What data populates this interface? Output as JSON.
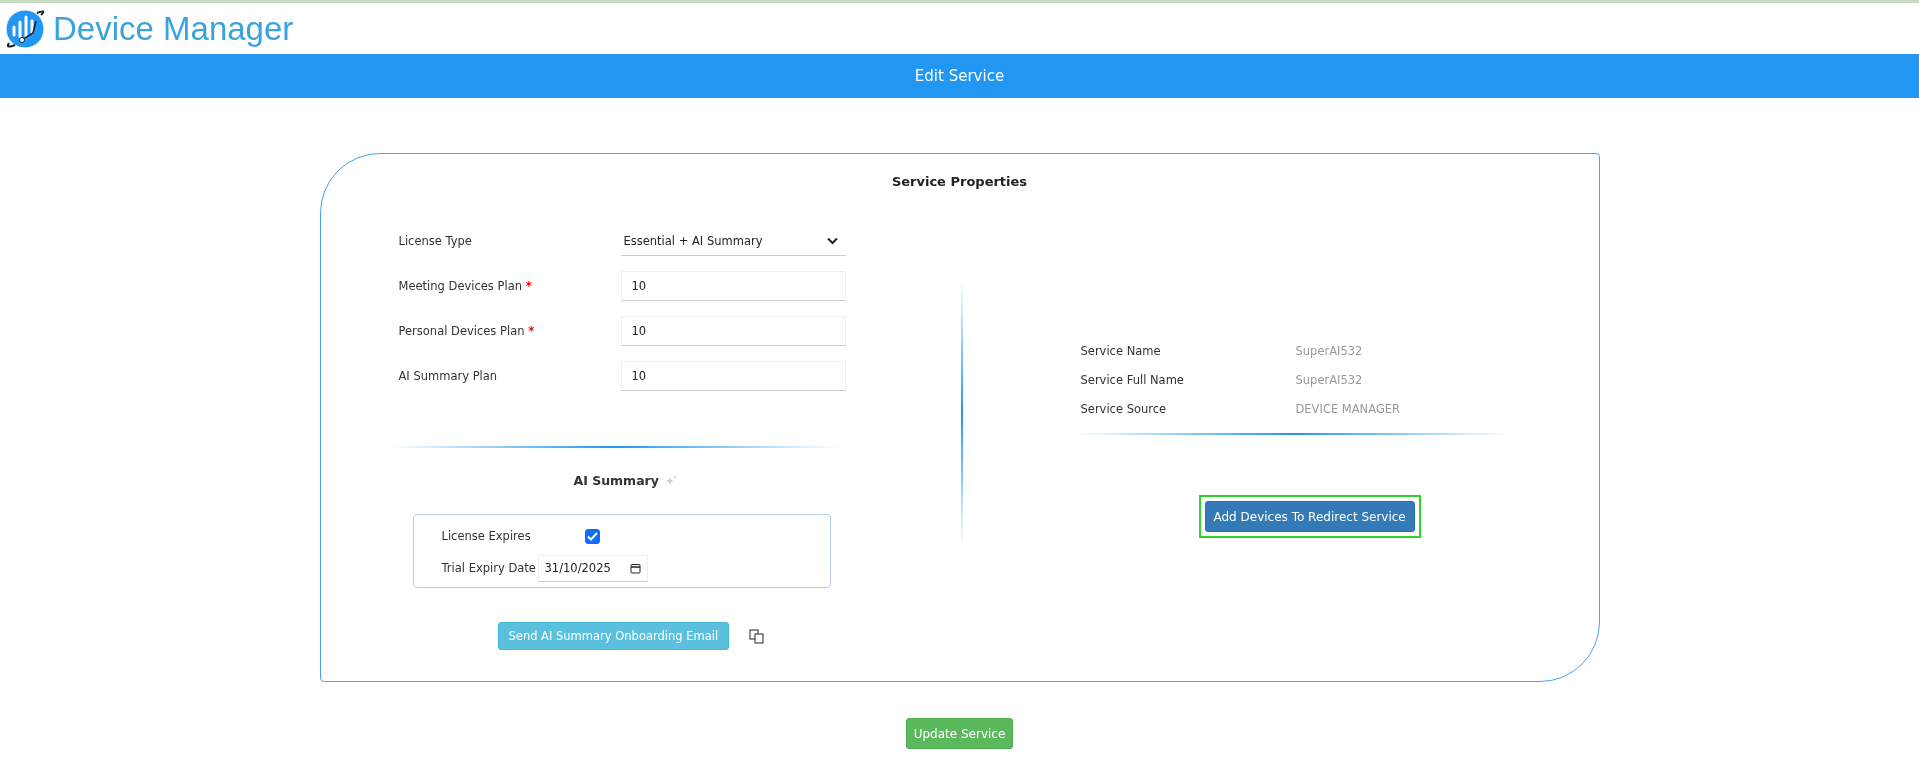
{
  "header": {
    "app_title": "Device Manager"
  },
  "page_bar": {
    "title": "Edit Service"
  },
  "card": {
    "title": "Service Properties",
    "fields": [
      {
        "kind": "select",
        "label": "License Type",
        "value": "Essential + AI Summary"
      },
      {
        "kind": "input",
        "label": "Meeting Devices Plan",
        "required_mark": "*",
        "value": "10"
      },
      {
        "kind": "input",
        "label": "Personal Devices Plan",
        "required_mark": "*",
        "value": "10"
      },
      {
        "kind": "input",
        "label": "AI Summary Plan",
        "value": "10"
      }
    ],
    "ai_summary": {
      "title": "AI Summary",
      "license_expires": {
        "label": "License Expires",
        "checked": true
      },
      "trial_expiry": {
        "label": "Trial Expiry Date",
        "value": "31/10/2025"
      },
      "send_button": "Send AI Summary Onboarding Email"
    },
    "service_info": [
      {
        "label": "Service Name",
        "value": "SuperAI532"
      },
      {
        "label": "Service Full Name",
        "value": "SuperAI532"
      },
      {
        "label": "Service Source",
        "value": "DEVICE MANAGER"
      }
    ],
    "redirect_button": {
      "label": "Add Devices To Redirect Service",
      "focused": true
    }
  },
  "update_button": "Update Service"
}
